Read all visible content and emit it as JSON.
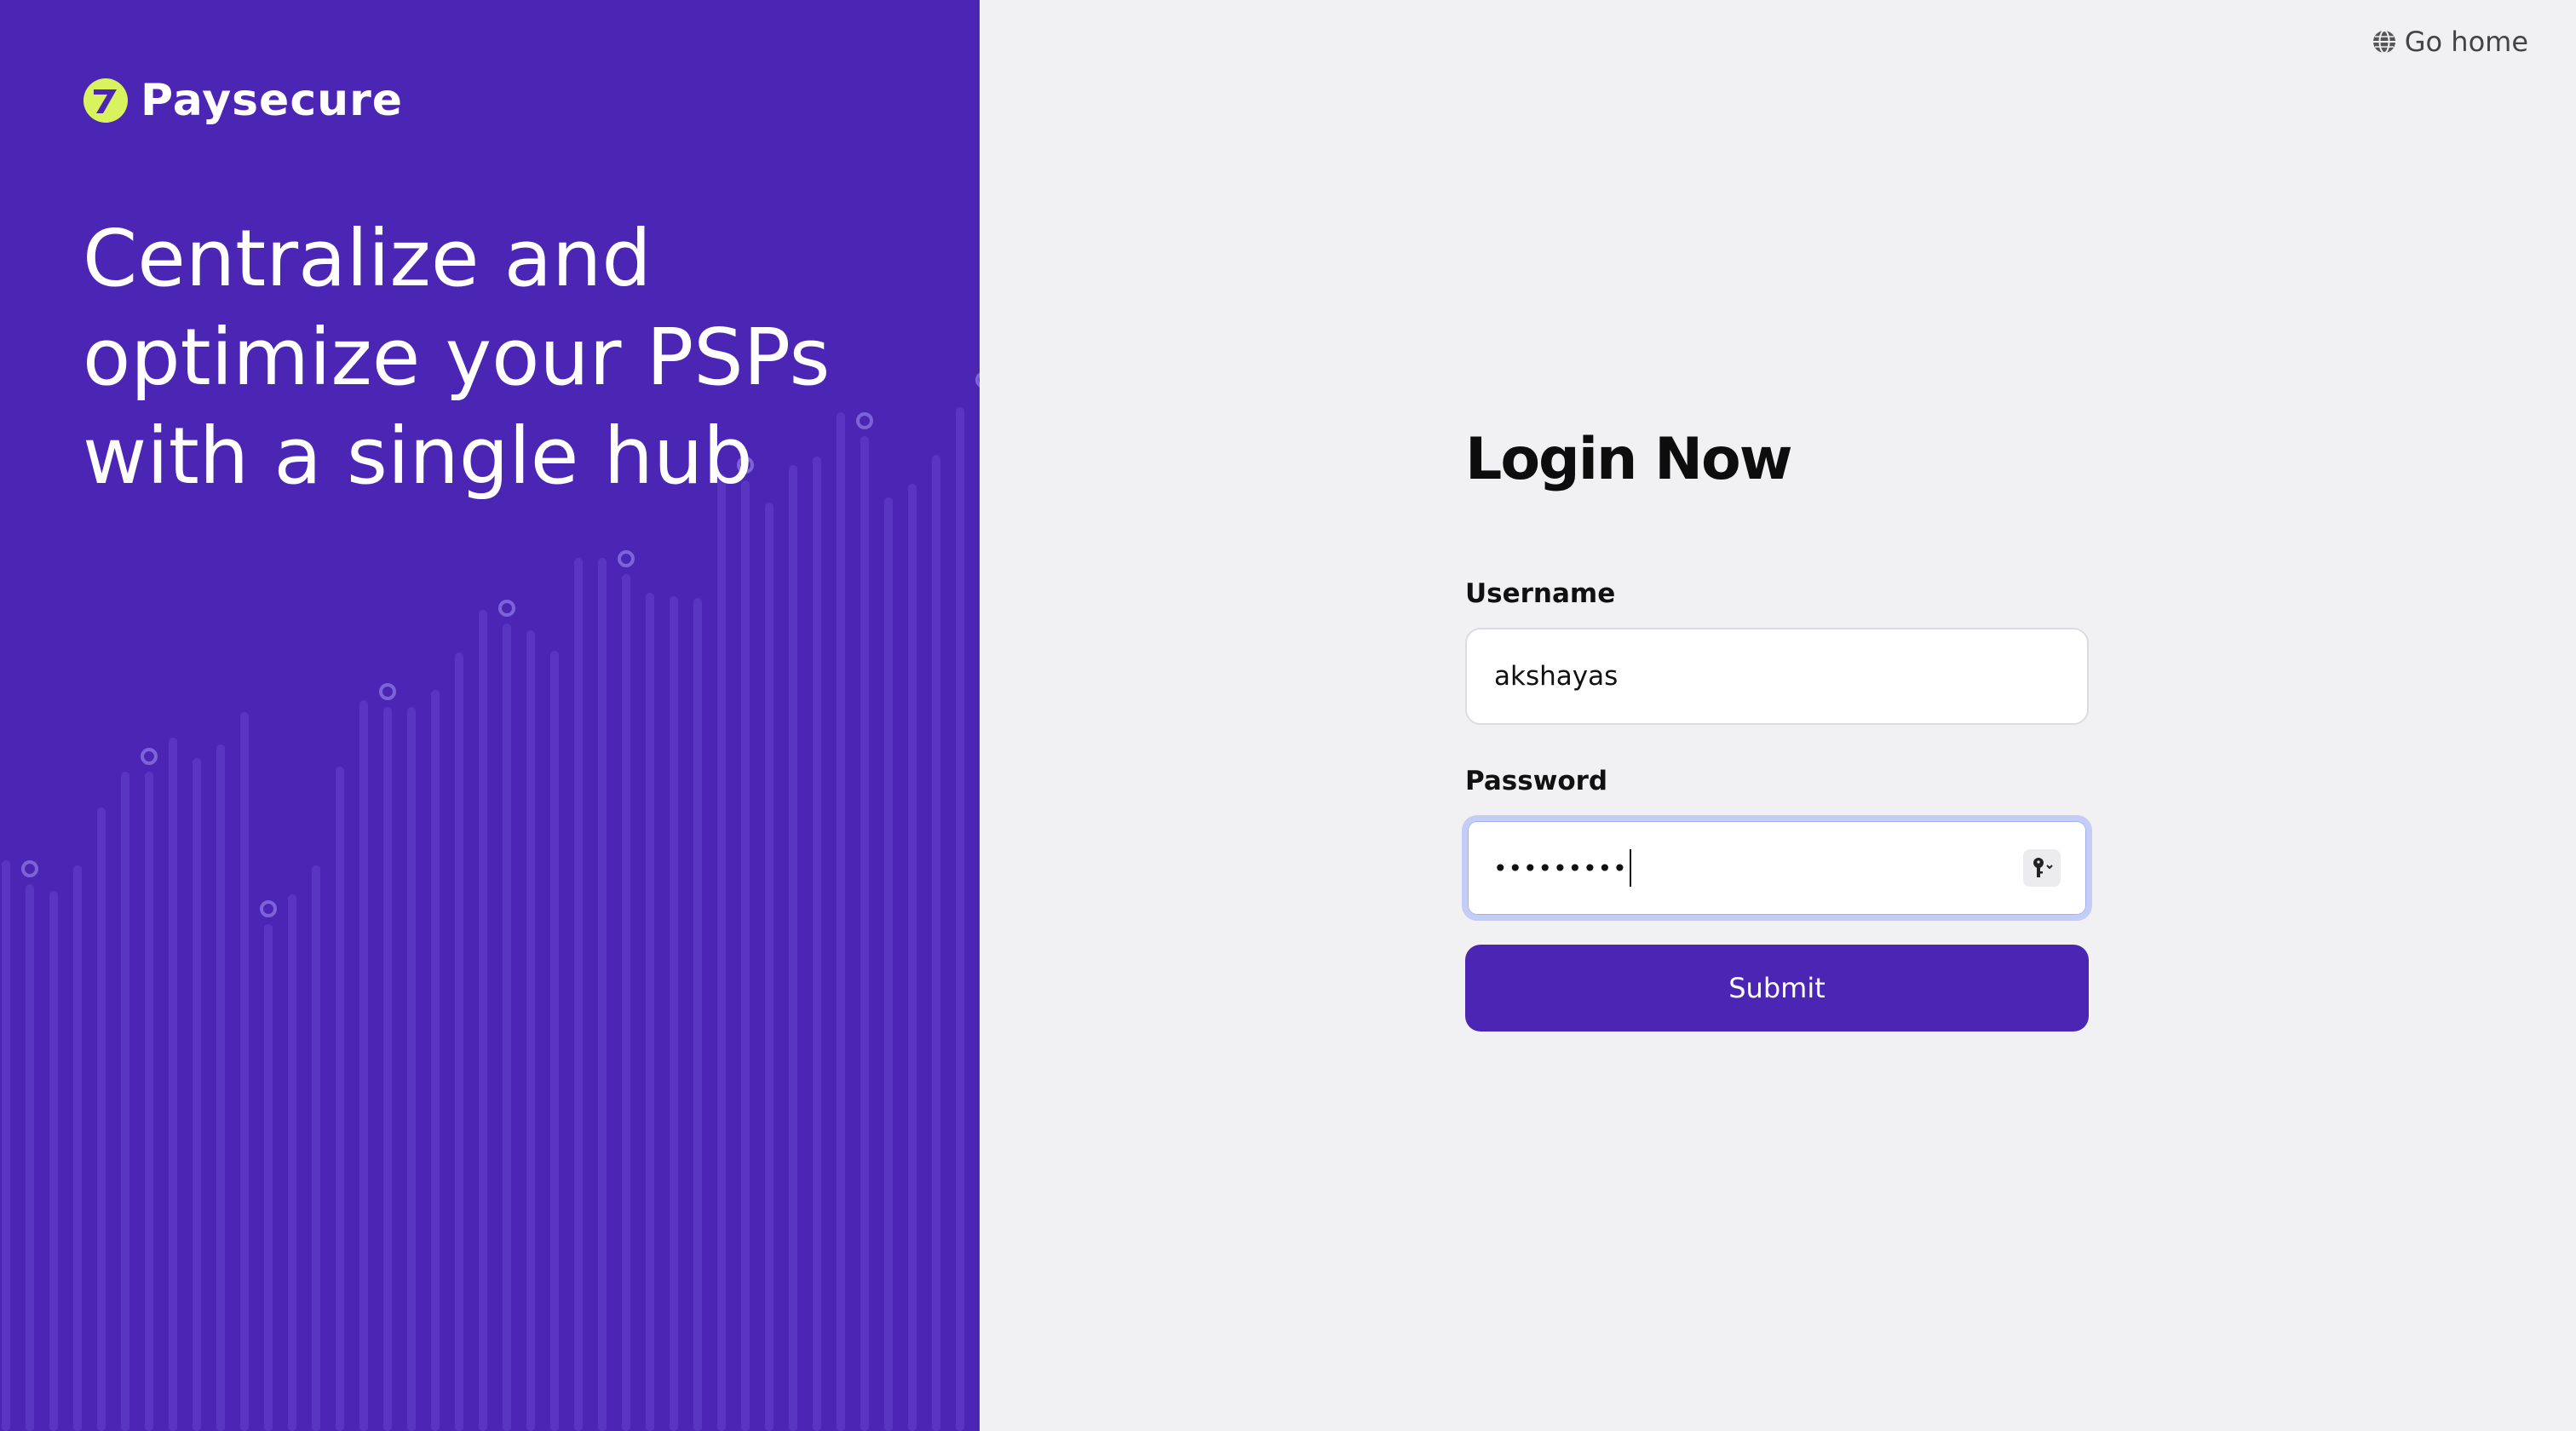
{
  "brand": {
    "name": "Paysecure",
    "accent_color": "#4b26b5",
    "logo_mark_color": "#d9f35f"
  },
  "hero": {
    "tagline_lines": [
      "Centralize and",
      "optimize your PSPs",
      "with a single hub"
    ]
  },
  "nav": {
    "go_home_label": "Go home",
    "go_home_icon": "globe-icon"
  },
  "login": {
    "title": "Login Now",
    "username_label": "Username",
    "username_value": "akshayas",
    "password_label": "Password",
    "password_masked": "•••••••••",
    "password_manager_icon": "key-icon",
    "submit_label": "Submit"
  }
}
